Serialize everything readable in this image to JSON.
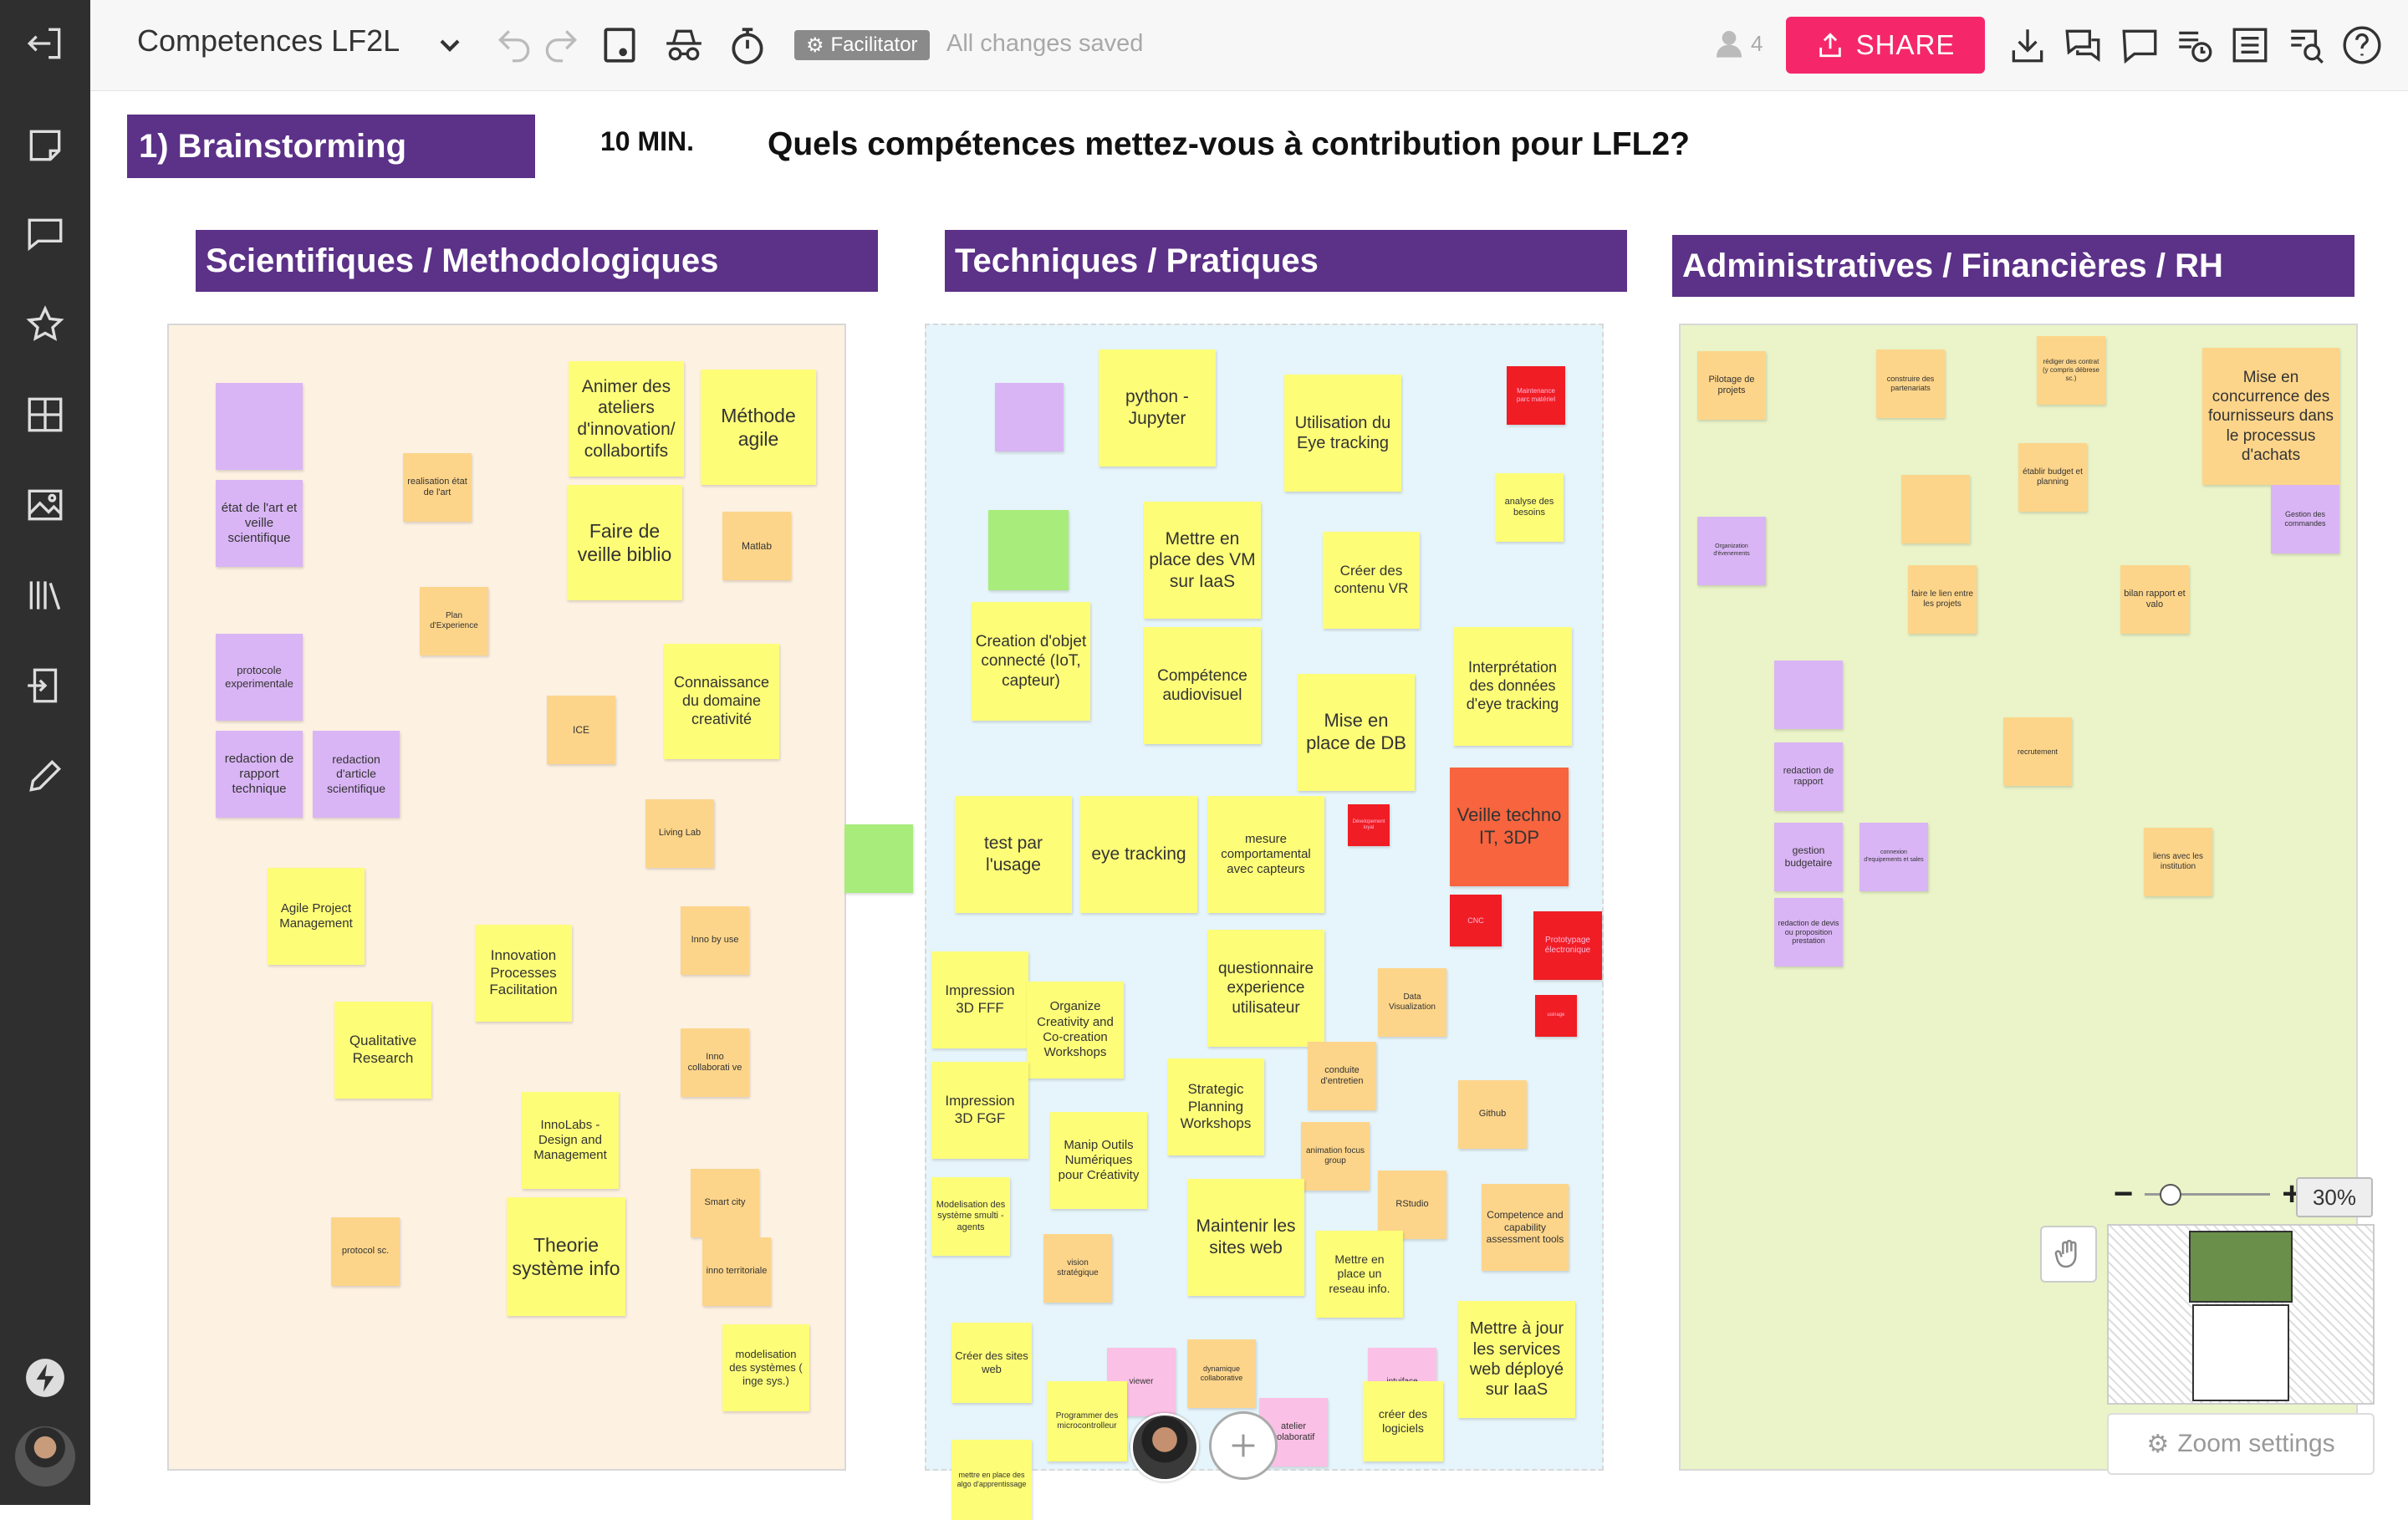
{
  "board": {
    "title": "Competences LF2L",
    "status": "All changes saved",
    "facilitator_badge": "Facilitator",
    "user_count": "4",
    "share_label": "SHARE"
  },
  "canvas": {
    "step_label": "1) Brainstorming",
    "timer": "10 MIN.",
    "question": "Quels compétences mettez-vous à contribution pour LFL2?",
    "columns": [
      "Scientifiques / Methodologiques",
      "Techniques / Pratiques",
      "Administratives / Financières / RH"
    ]
  },
  "notes": [
    {
      "t": "",
      "c": "p"
    },
    {
      "t": "état de l'art et veille scientifique",
      "c": "p"
    },
    {
      "t": "realisation état de l'art",
      "c": "o"
    },
    {
      "t": "Animer des ateliers d'innovation/ collabortifs",
      "c": "y"
    },
    {
      "t": "Méthode agile",
      "c": "y"
    },
    {
      "t": "Faire de veille biblio",
      "c": "y"
    },
    {
      "t": "Matlab",
      "c": "o"
    },
    {
      "t": "Plan d'Experience",
      "c": "o"
    },
    {
      "t": "protocole experimentale",
      "c": "p"
    },
    {
      "t": "Connaissance du domaine creativité",
      "c": "y"
    },
    {
      "t": "ICE",
      "c": "o"
    },
    {
      "t": "redaction de rapport technique",
      "c": "p"
    },
    {
      "t": "redaction d'article scientifique",
      "c": "p"
    },
    {
      "t": "Living Lab",
      "c": "o"
    },
    {
      "t": "Agile Project Management",
      "c": "y"
    },
    {
      "t": "Inno by use",
      "c": "o"
    },
    {
      "t": "Innovation Processes Facilitation",
      "c": "y"
    },
    {
      "t": "Qualitative Research",
      "c": "y"
    },
    {
      "t": "Inno collaborati ve",
      "c": "o"
    },
    {
      "t": "InnoLabs - Design and Management",
      "c": "y"
    },
    {
      "t": "Smart city",
      "c": "o"
    },
    {
      "t": "protocol sc.",
      "c": "o"
    },
    {
      "t": "Theorie système info",
      "c": "y"
    },
    {
      "t": "inno territoriale",
      "c": "o"
    },
    {
      "t": "modelisation des systèmes ( inge sys.)",
      "c": "y"
    },
    {
      "t": "",
      "c": "g"
    },
    {
      "t": "",
      "c": "p"
    },
    {
      "t": "python - Jupyter",
      "c": "y"
    },
    {
      "t": "Utilisation du Eye tracking",
      "c": "y"
    },
    {
      "t": "Maintenance parc matériel",
      "c": "r"
    },
    {
      "t": "analyse des besoins",
      "c": "y"
    },
    {
      "t": "",
      "c": "g"
    },
    {
      "t": "Mettre en place des VM sur IaaS",
      "c": "y"
    },
    {
      "t": "Créer des contenu VR",
      "c": "y"
    },
    {
      "t": "Creation d'objet connecté (IoT, capteur)",
      "c": "y"
    },
    {
      "t": "Compétence audiovisuel",
      "c": "y"
    },
    {
      "t": "Interprétation des données d'eye tracking",
      "c": "y"
    },
    {
      "t": "Mise en place de DB",
      "c": "y"
    },
    {
      "t": "Veille techno IT, 3DP",
      "c": "or"
    },
    {
      "t": "test par l'usage",
      "c": "y"
    },
    {
      "t": "eye tracking",
      "c": "y"
    },
    {
      "t": "mesure comportamental avec capteurs",
      "c": "y"
    },
    {
      "t": "Dévelopement loyal",
      "c": "r"
    },
    {
      "t": "CNC",
      "c": "r"
    },
    {
      "t": "Prototypage électronique",
      "c": "r"
    },
    {
      "t": "questionnaire experience utilisateur",
      "c": "y"
    },
    {
      "t": "Impression 3D FFF",
      "c": "y"
    },
    {
      "t": "Organize Creativity and Co-creation Workshops",
      "c": "y"
    },
    {
      "t": "Data Visualization",
      "c": "o"
    },
    {
      "t": "usinage",
      "c": "r"
    },
    {
      "t": "Impression 3D FGF",
      "c": "y"
    },
    {
      "t": "Strategic Planning Workshops",
      "c": "y"
    },
    {
      "t": "conduite d'entretien",
      "c": "o"
    },
    {
      "t": "Manip Outils Numériques pour Créativity",
      "c": "y"
    },
    {
      "t": "animation focus group",
      "c": "o"
    },
    {
      "t": "Github",
      "c": "o"
    },
    {
      "t": "Modelisation des système smulti -agents",
      "c": "y"
    },
    {
      "t": "Maintenir les sites web",
      "c": "y"
    },
    {
      "t": "RStudio",
      "c": "o"
    },
    {
      "t": "Competence and capability assessment tools",
      "c": "o"
    },
    {
      "t": "vision stratégique",
      "c": "o"
    },
    {
      "t": "Mettre en place un reseau info.",
      "c": "y"
    },
    {
      "t": "Mettre à jour les services web déployé sur IaaS",
      "c": "y"
    },
    {
      "t": "Créer des sites web",
      "c": "y"
    },
    {
      "t": "viewer",
      "c": "pk"
    },
    {
      "t": "dynamique collaborative",
      "c": "o"
    },
    {
      "t": "intuiface",
      "c": "pk"
    },
    {
      "t": "Programmer des microcontrolleur",
      "c": "y"
    },
    {
      "t": "atelier colaboratif",
      "c": "pk"
    },
    {
      "t": "créer des logiciels",
      "c": "y"
    },
    {
      "t": "mettre en place des algo d'apprentissage",
      "c": "y"
    },
    {
      "t": "Pilotage de projets",
      "c": "o"
    },
    {
      "t": "construire des partenariats",
      "c": "o"
    },
    {
      "t": "rédiger des contrat (y compris débrese sc.)",
      "c": "o"
    },
    {
      "t": "Mise en concurrence des fournisseurs dans le processus d'achats",
      "c": "o"
    },
    {
      "t": "établir budget et planning",
      "c": "o"
    },
    {
      "t": "",
      "c": "o"
    },
    {
      "t": "Gestion des commandes",
      "c": "p"
    },
    {
      "t": "Organization d'évenements",
      "c": "p"
    },
    {
      "t": "faire le lien entre les projets",
      "c": "o"
    },
    {
      "t": "bilan rapport et valo",
      "c": "o"
    },
    {
      "t": "",
      "c": "p"
    },
    {
      "t": "recrutement",
      "c": "o"
    },
    {
      "t": "redaction de rapport",
      "c": "p"
    },
    {
      "t": "gestion budgetaire",
      "c": "p"
    },
    {
      "t": "connexion d'equipements et sales",
      "c": "p"
    },
    {
      "t": "liens avec les institution",
      "c": "o"
    },
    {
      "t": "redaction de devis ou proposition prestation",
      "c": "p"
    }
  ],
  "zoom": {
    "percent": "30%",
    "settings_label": "Zoom settings"
  }
}
